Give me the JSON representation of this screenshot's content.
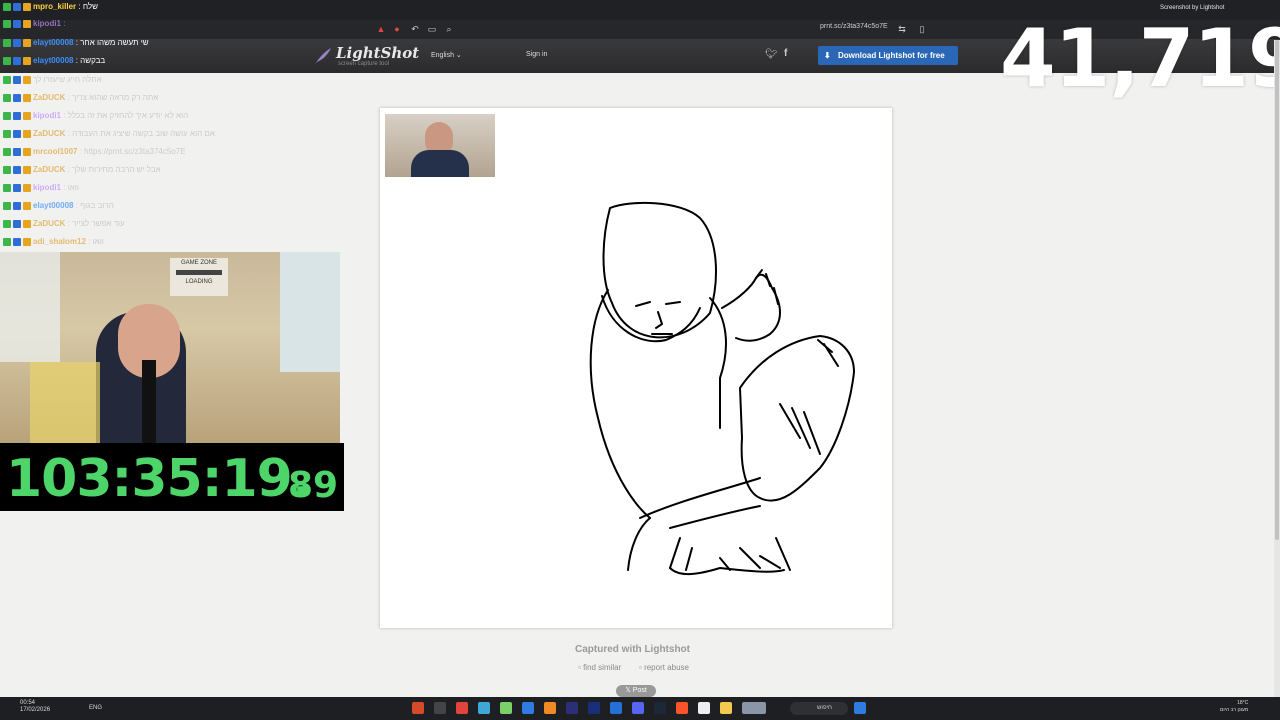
{
  "browser": {
    "tab_title": "Screenshot by Lightshot",
    "url": "prnt.sc/z3ta374c5o7E"
  },
  "site": {
    "logo_text": "LightShot",
    "logo_sub": "screen capture tool",
    "language": "English",
    "signin": "Sign in",
    "download_button": "Download Lightshot for free",
    "captured": "Captured with Lightshot",
    "find_similar": "find similar",
    "report_abuse": "report abuse",
    "post": "Post"
  },
  "stream": {
    "counter": "41,719",
    "timer_main": "103:35:19.",
    "timer_frac": "89",
    "webcam_text_1": "GAME ZONE",
    "webcam_text_2": "LOADING"
  },
  "chat": [
    {
      "user": "mpro_killer",
      "msg": "שלח",
      "color": "#ffd23d",
      "dim": false
    },
    {
      "user": "kipodi1",
      "msg": "",
      "color": "#c28cff",
      "dim": true
    },
    {
      "user": "elayt00008",
      "msg": "שי תעשה משהו אחר",
      "color": "#3a8fff",
      "dim": false
    },
    {
      "user": "elayt00008",
      "msg": "בבקשה",
      "color": "#3a8fff",
      "dim": false
    },
    {
      "user": "",
      "msg": "אחלה חייג שיעזרו לך",
      "color": "#e0a43b",
      "dim": true
    },
    {
      "user": "ZaDUCK",
      "msg": "אתה רק מראה שהוא צריך",
      "color": "#e0a43b",
      "dim": true
    },
    {
      "user": "kipodi1",
      "msg": "הוא לא יודע איך להחזיק את זה בכלל",
      "color": "#c28cff",
      "dim": true
    },
    {
      "user": "ZaDUCK",
      "msg": "אם הוא עושה שוב בקשה שיציג את העבודה",
      "color": "#e0a43b",
      "dim": true
    },
    {
      "user": "mrcool1007",
      "msg": "https://prnt.sc/z3ta374c5o7E",
      "color": "#e0a43b",
      "dim": true
    },
    {
      "user": "ZaDUCK",
      "msg": "אבל יש הרבה מחירות שלך",
      "color": "#e0a43b",
      "dim": true
    },
    {
      "user": "kipodi1",
      "msg": "וואו",
      "color": "#c28cff",
      "dim": true
    },
    {
      "user": "elayt00008",
      "msg": "הרוב בגוף",
      "color": "#3a8fff",
      "dim": true
    },
    {
      "user": "ZaDUCK",
      "msg": "עוד אפשר לצייר",
      "color": "#e0a43b",
      "dim": true
    },
    {
      "user": "adi_shalom12",
      "msg": "וואו",
      "color": "#e0a43b",
      "dim": true
    }
  ],
  "taskbar": {
    "time": "00:54",
    "date": "17/02/2026",
    "lang": "ENG",
    "search": "חיפוש",
    "weather": "18°C",
    "weather_desc": "מעונן רב היום"
  },
  "colors": {
    "accent_blue": "#2a67b6",
    "timer_green": "#4ed56a",
    "page_bg": "#f1f1ef"
  }
}
